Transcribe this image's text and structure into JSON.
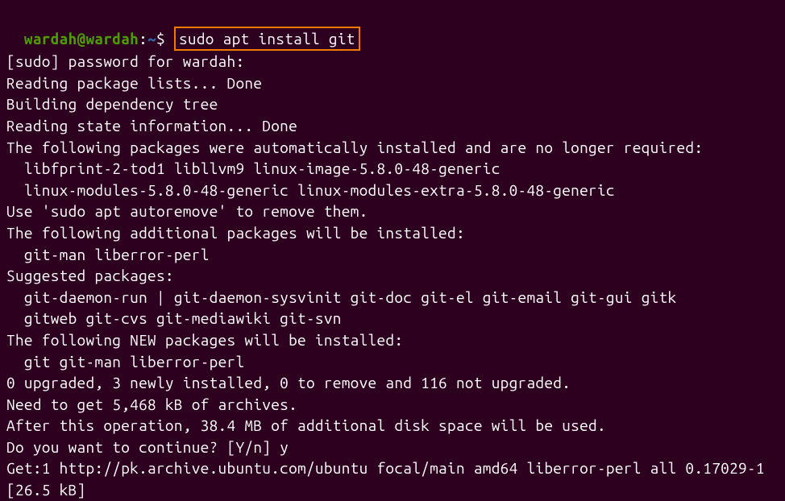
{
  "prompt": {
    "user_host": "wardah@wardah",
    "separator": ":",
    "path": "~",
    "symbol": "$",
    "command": "sudo apt install git"
  },
  "output": {
    "line1": "[sudo] password for wardah:",
    "line2": "Reading package lists... Done",
    "line3": "Building dependency tree",
    "line4": "Reading state information... Done",
    "line5": "The following packages were automatically installed and are no longer required:",
    "line6": "  libfprint-2-tod1 libllvm9 linux-image-5.8.0-48-generic",
    "line7": "  linux-modules-5.8.0-48-generic linux-modules-extra-5.8.0-48-generic",
    "line8": "Use 'sudo apt autoremove' to remove them.",
    "line9": "The following additional packages will be installed:",
    "line10": "  git-man liberror-perl",
    "line11": "Suggested packages:",
    "line12": "  git-daemon-run | git-daemon-sysvinit git-doc git-el git-email git-gui gitk",
    "line13": "  gitweb git-cvs git-mediawiki git-svn",
    "line14": "The following NEW packages will be installed:",
    "line15": "  git git-man liberror-perl",
    "line16": "0 upgraded, 3 newly installed, 0 to remove and 116 not upgraded.",
    "line17": "Need to get 5,468 kB of archives.",
    "line18": "After this operation, 38.4 MB of additional disk space will be used.",
    "line19": "Do you want to continue? [Y/n] y",
    "line20": "Get:1 http://pk.archive.ubuntu.com/ubuntu focal/main amd64 liberror-perl all 0.17029-1 [26.5 kB]"
  }
}
